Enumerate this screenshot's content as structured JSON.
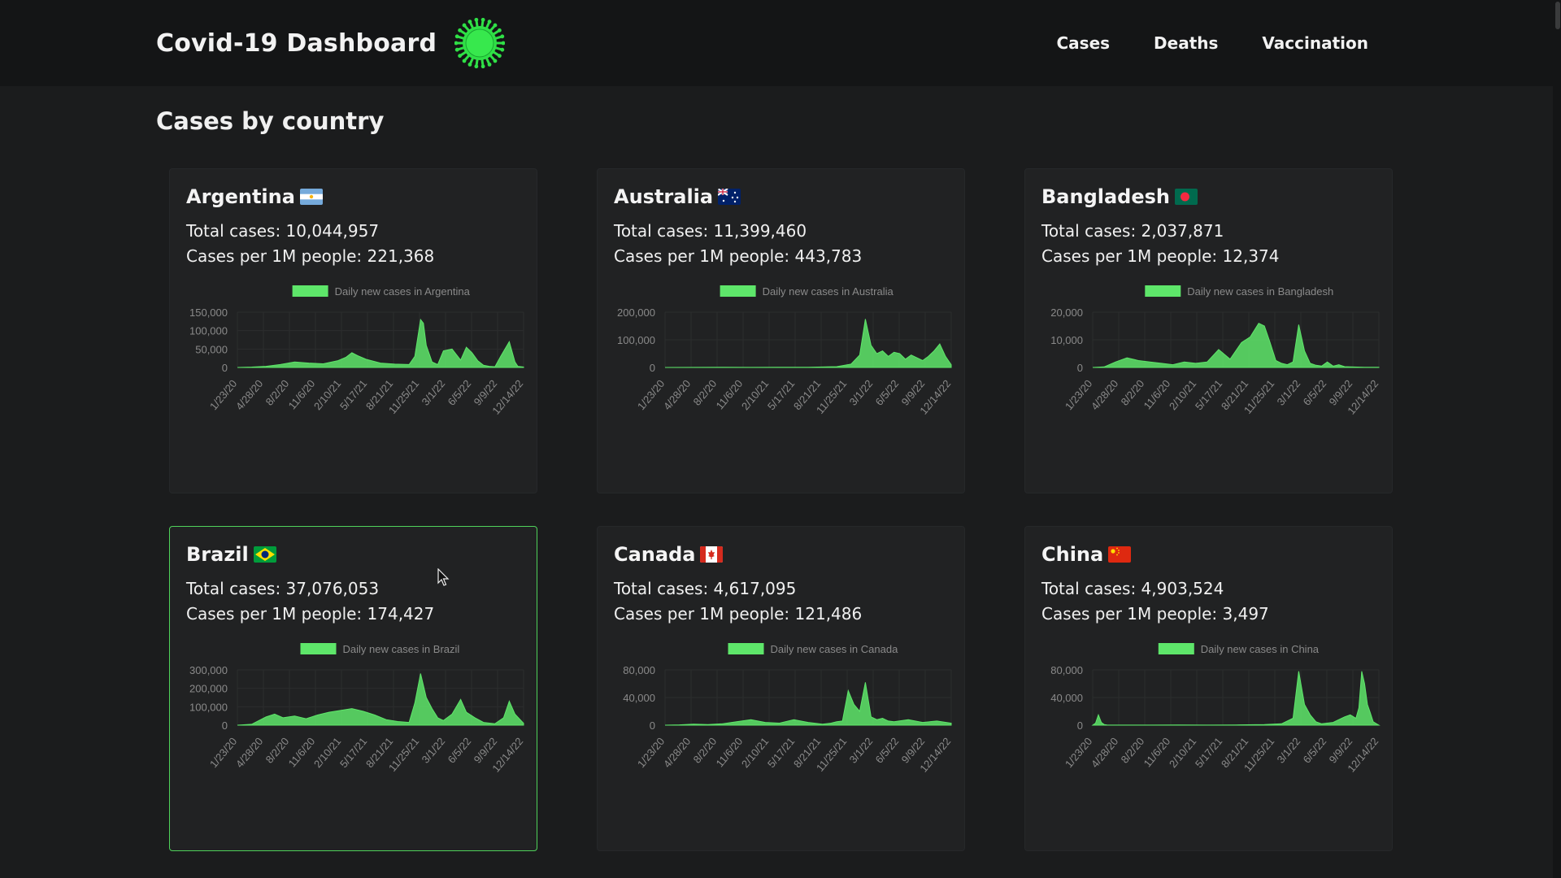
{
  "header": {
    "title": "Covid-19 Dashboard",
    "logo_icon": "virus-icon",
    "nav": [
      "Cases",
      "Deaths",
      "Vaccination"
    ]
  },
  "page_title": "Cases by country",
  "colors": {
    "accent": "#4fd25a",
    "series_fill": "#5ee66a",
    "background": "#1b1c1d",
    "card_bg": "#212223"
  },
  "x_tick_labels": [
    "1/23/20",
    "4/28/20",
    "8/2/20",
    "11/6/20",
    "2/10/21",
    "5/17/21",
    "8/21/21",
    "11/25/21",
    "3/1/22",
    "6/5/22",
    "9/9/22",
    "12/14/22"
  ],
  "cards": [
    {
      "country": "Argentina",
      "flag_icon": "argentina-flag-icon",
      "total": "Total cases: 10,044,957",
      "per_million": "Cases per 1M people: 221,368",
      "selected": false
    },
    {
      "country": "Australia",
      "flag_icon": "australia-flag-icon",
      "total": "Total cases: 11,399,460",
      "per_million": "Cases per 1M people: 443,783",
      "selected": false
    },
    {
      "country": "Bangladesh",
      "flag_icon": "bangladesh-flag-icon",
      "total": "Total cases: 2,037,871",
      "per_million": "Cases per 1M people: 12,374",
      "selected": false
    },
    {
      "country": "Brazil",
      "flag_icon": "brazil-flag-icon",
      "total": "Total cases: 37,076,053",
      "per_million": "Cases per 1M people: 174,427",
      "selected": true
    },
    {
      "country": "Canada",
      "flag_icon": "canada-flag-icon",
      "total": "Total cases: 4,617,095",
      "per_million": "Cases per 1M people: 121,486",
      "selected": false
    },
    {
      "country": "China",
      "flag_icon": "china-flag-icon",
      "total": "Total cases: 4,903,524",
      "per_million": "Cases per 1M people: 3,497",
      "selected": false
    }
  ],
  "chart_data": [
    {
      "type": "area",
      "legend": "Daily new cases in Argentina",
      "ylim": [
        0,
        150000
      ],
      "yticks": [
        "150,000",
        "100,000",
        "50,000",
        "0"
      ],
      "ytick_values": [
        150000,
        100000,
        50000,
        0
      ],
      "x": [
        0,
        0.05,
        0.1,
        0.15,
        0.2,
        0.25,
        0.3,
        0.35,
        0.38,
        0.4,
        0.42,
        0.45,
        0.5,
        0.55,
        0.6,
        0.62,
        0.64,
        0.65,
        0.66,
        0.68,
        0.7,
        0.72,
        0.75,
        0.78,
        0.8,
        0.82,
        0.84,
        0.86,
        0.88,
        0.9,
        0.92,
        0.95,
        0.97,
        0.98,
        1.0
      ],
      "y": [
        0,
        1000,
        3000,
        8000,
        15000,
        12000,
        10000,
        18000,
        28000,
        40000,
        32000,
        22000,
        12000,
        9000,
        8000,
        30000,
        130000,
        120000,
        60000,
        15000,
        8000,
        45000,
        50000,
        20000,
        55000,
        40000,
        18000,
        6000,
        3000,
        2000,
        30000,
        70000,
        15000,
        3000,
        1000
      ]
    },
    {
      "type": "area",
      "legend": "Daily new cases in Australia",
      "ylim": [
        0,
        200000
      ],
      "yticks": [
        "200,000",
        "100,000",
        "0"
      ],
      "ytick_values": [
        200000,
        100000,
        0
      ],
      "x": [
        0,
        0.1,
        0.2,
        0.3,
        0.4,
        0.5,
        0.6,
        0.65,
        0.68,
        0.7,
        0.72,
        0.74,
        0.76,
        0.78,
        0.8,
        0.82,
        0.84,
        0.86,
        0.88,
        0.9,
        0.92,
        0.94,
        0.96,
        0.98,
        1.0
      ],
      "y": [
        0,
        200,
        500,
        400,
        800,
        1000,
        3000,
        12000,
        45000,
        175000,
        80000,
        50000,
        60000,
        40000,
        55000,
        50000,
        30000,
        45000,
        35000,
        25000,
        40000,
        60000,
        85000,
        40000,
        10000
      ]
    },
    {
      "type": "area",
      "legend": "Daily new cases in Bangladesh",
      "ylim": [
        0,
        20000
      ],
      "yticks": [
        "20,000",
        "10,000",
        "0"
      ],
      "ytick_values": [
        20000,
        10000,
        0
      ],
      "x": [
        0,
        0.04,
        0.08,
        0.12,
        0.16,
        0.2,
        0.24,
        0.28,
        0.32,
        0.36,
        0.4,
        0.44,
        0.48,
        0.52,
        0.55,
        0.58,
        0.6,
        0.62,
        0.64,
        0.66,
        0.68,
        0.7,
        0.72,
        0.74,
        0.76,
        0.78,
        0.8,
        0.82,
        0.84,
        0.86,
        0.88,
        0.9,
        0.95,
        1.0
      ],
      "y": [
        0,
        200,
        2000,
        3500,
        2500,
        2000,
        1500,
        1000,
        2000,
        1500,
        2000,
        6500,
        3000,
        9000,
        11000,
        16000,
        15000,
        9000,
        2500,
        1500,
        1000,
        2000,
        15500,
        6000,
        1500,
        800,
        500,
        2000,
        500,
        1000,
        300,
        200,
        100,
        50
      ]
    },
    {
      "type": "area",
      "legend": "Daily new cases in Brazil",
      "ylim": [
        0,
        300000
      ],
      "yticks": [
        "300,000",
        "200,000",
        "100,000",
        "0"
      ],
      "ytick_values": [
        300000,
        200000,
        100000,
        0
      ],
      "x": [
        0,
        0.05,
        0.1,
        0.13,
        0.16,
        0.2,
        0.24,
        0.28,
        0.32,
        0.36,
        0.4,
        0.44,
        0.48,
        0.52,
        0.56,
        0.6,
        0.62,
        0.64,
        0.66,
        0.68,
        0.7,
        0.72,
        0.75,
        0.78,
        0.8,
        0.83,
        0.86,
        0.9,
        0.93,
        0.95,
        0.97,
        1.0
      ],
      "y": [
        0,
        5000,
        45000,
        60000,
        40000,
        50000,
        35000,
        55000,
        70000,
        80000,
        90000,
        75000,
        55000,
        30000,
        20000,
        15000,
        120000,
        280000,
        150000,
        90000,
        40000,
        25000,
        60000,
        140000,
        70000,
        40000,
        15000,
        8000,
        40000,
        130000,
        60000,
        10000
      ]
    },
    {
      "type": "area",
      "legend": "Daily new cases in Canada",
      "ylim": [
        0,
        80000
      ],
      "yticks": [
        "80,000",
        "40,000",
        "0"
      ],
      "ytick_values": [
        80000,
        40000,
        0
      ],
      "x": [
        0,
        0.05,
        0.1,
        0.15,
        0.2,
        0.25,
        0.3,
        0.35,
        0.4,
        0.45,
        0.5,
        0.55,
        0.58,
        0.6,
        0.62,
        0.64,
        0.66,
        0.68,
        0.7,
        0.72,
        0.74,
        0.76,
        0.78,
        0.8,
        0.85,
        0.9,
        0.95,
        1.0
      ],
      "y": [
        0,
        500,
        1500,
        1000,
        2000,
        5000,
        8000,
        4000,
        3000,
        8000,
        4000,
        1500,
        3000,
        5000,
        6000,
        50000,
        30000,
        20000,
        62000,
        12000,
        8000,
        10000,
        6000,
        5000,
        8000,
        4000,
        6000,
        3000
      ]
    },
    {
      "type": "area",
      "legend": "Daily new cases in China",
      "ylim": [
        0,
        80000
      ],
      "yticks": [
        "80,000",
        "40,000",
        "0"
      ],
      "ytick_values": [
        80000,
        40000,
        0
      ],
      "x": [
        0,
        0.01,
        0.02,
        0.03,
        0.04,
        0.05,
        0.1,
        0.2,
        0.3,
        0.4,
        0.5,
        0.6,
        0.66,
        0.7,
        0.72,
        0.74,
        0.76,
        0.78,
        0.8,
        0.84,
        0.88,
        0.9,
        0.92,
        0.93,
        0.94,
        0.95,
        0.96,
        0.97,
        0.98,
        1.0
      ],
      "y": [
        0,
        3000,
        15000,
        4000,
        1000,
        300,
        100,
        100,
        200,
        100,
        300,
        800,
        2000,
        10000,
        78000,
        30000,
        15000,
        5000,
        2000,
        4000,
        12000,
        15000,
        10000,
        25000,
        78000,
        60000,
        30000,
        18000,
        5000,
        0
      ]
    }
  ]
}
